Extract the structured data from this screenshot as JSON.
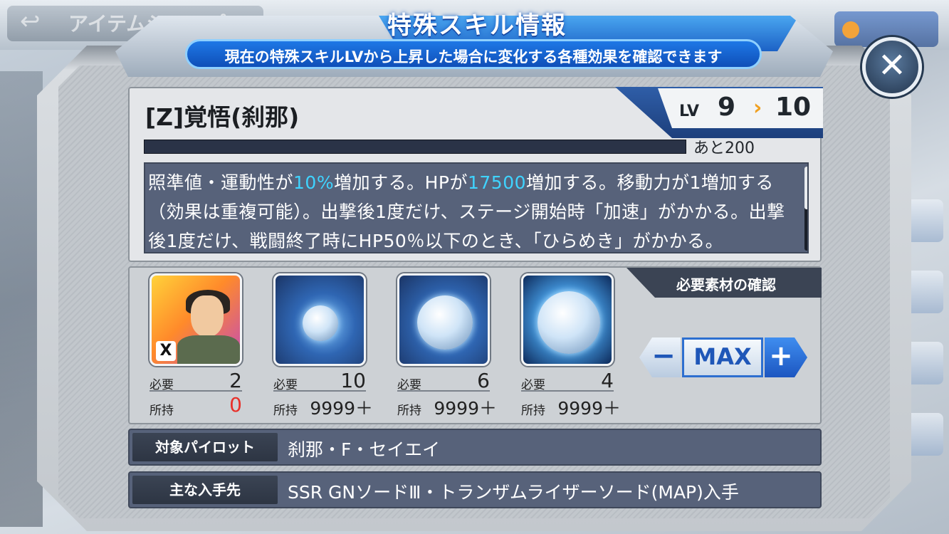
{
  "background": {
    "back_label": "アイテムショップ",
    "back_icon": "back-arrow-icon"
  },
  "header": {
    "title": "特殊スキル情報",
    "subtitle": "現在の特殊スキルLVから上昇した場合に変化する各種効果を確認できます"
  },
  "close_icon": "close-icon",
  "skill": {
    "name": "[Z]覚悟(刹那)",
    "lv_label": "LV",
    "lv_from": "9",
    "lv_arrow": "›",
    "lv_to": "10",
    "remaining": "あと200",
    "description_parts": {
      "p1": "照準値・運動性が",
      "v1": "10%",
      "p2": "増加する。HPが",
      "v2": "17500",
      "p3": "増加する。移動力が1増加する（効果は重複可能）。出撃後1度だけ、ステージ開始時「加速」がかかる。出撃後1度だけ、戦闘終了時にHP50％以下のとき、「ひらめき」がかかる。"
    }
  },
  "materials": {
    "header": "必要素材の確認",
    "need_label": "必要",
    "have_label": "所持",
    "items": [
      {
        "icon": "pilot-character-icon",
        "badge": "X",
        "need": "2",
        "have": "0"
      },
      {
        "icon": "small-orb-icon",
        "need": "10",
        "have": "9999＋"
      },
      {
        "icon": "medium-orb-icon",
        "need": "6",
        "have": "9999＋"
      },
      {
        "icon": "large-orb-icon",
        "need": "4",
        "have": "9999＋"
      }
    ],
    "controls": {
      "minus": "−",
      "max": "MAX",
      "plus": "+"
    }
  },
  "info": {
    "target_label": "対象パイロット",
    "target_value": "刹那・F・セイエイ",
    "source_label": "主な入手先",
    "source_value": "SSR GNソードⅢ・トランザムライザーソード(MAP)入手"
  },
  "colors": {
    "accent_blue": "#1c62c6",
    "highlight_cyan": "#3fd3ff",
    "zero_red": "#e8302a",
    "lv_arrow_orange": "#f0a020"
  }
}
